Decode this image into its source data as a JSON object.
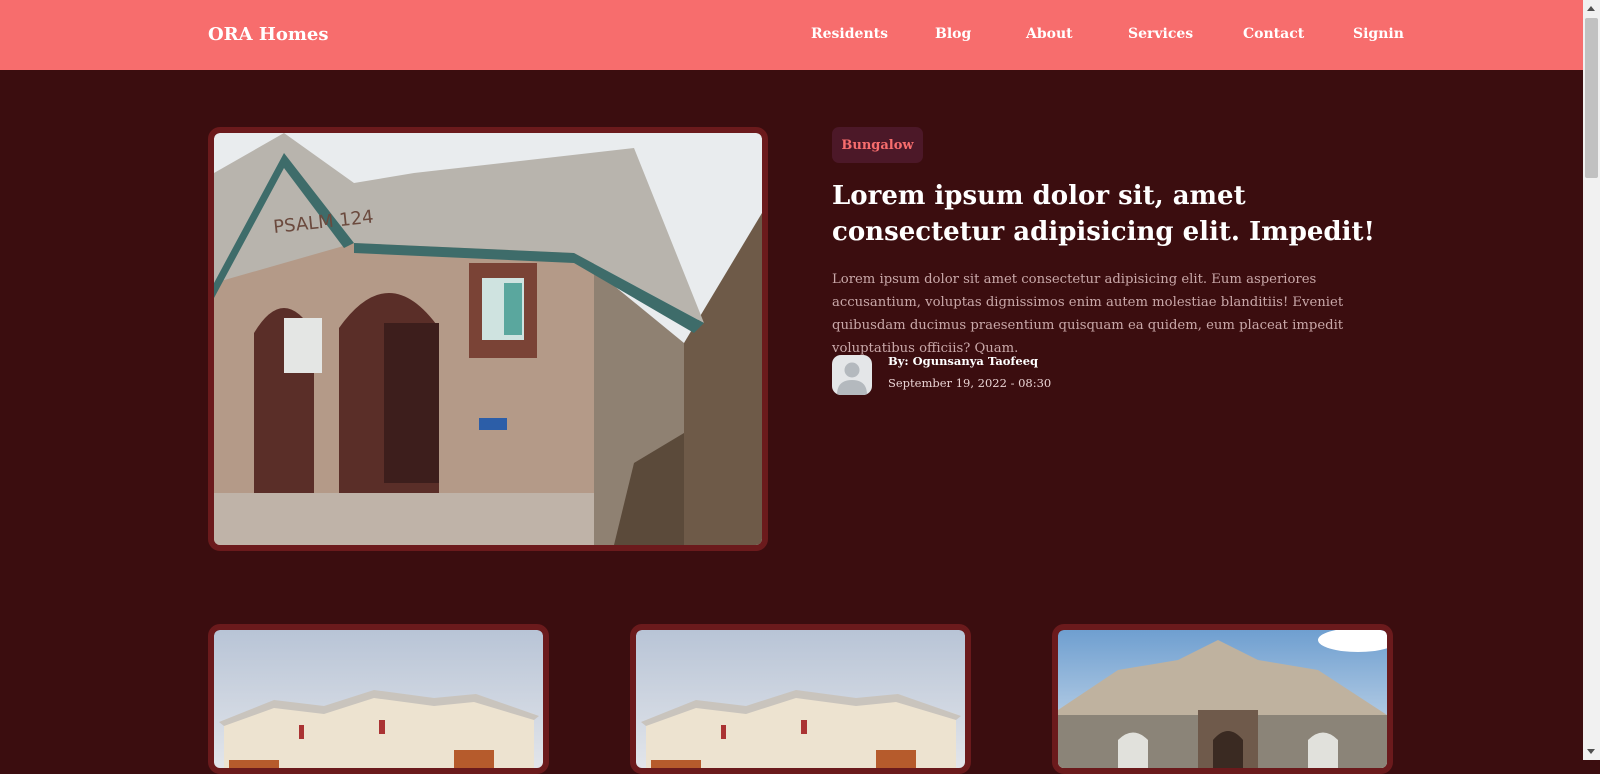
{
  "header": {
    "brand": "ORA Homes",
    "nav": [
      "Residents",
      "Blog",
      "About",
      "Services",
      "Contact",
      "Signin"
    ]
  },
  "featured": {
    "category": "Bungalow",
    "title": "Lorem ipsum dolor sit, amet consectetur adipisicing elit. Impedit!",
    "excerpt": "Lorem ipsum dolor sit amet consectetur adipisicing elit. Eum asperiores accusantium, voluptas dignissimos enim autem molestiae blanditiis! Eveniet quibusdam ducimus praesentium quisquam ea quidem, eum placeat impedit voluptatibus officiis? Quam.",
    "author": "By: Ogunsanya Taofeeq",
    "date": "September 19, 2022 - 08:30",
    "image_inscription": "PSALM 124"
  },
  "colors": {
    "header": "#f76d6d",
    "page_background": "#3b0d0f",
    "card_frame": "#6b1a1c",
    "badge_background": "#4c1828",
    "badge_text": "#f76d6d"
  }
}
